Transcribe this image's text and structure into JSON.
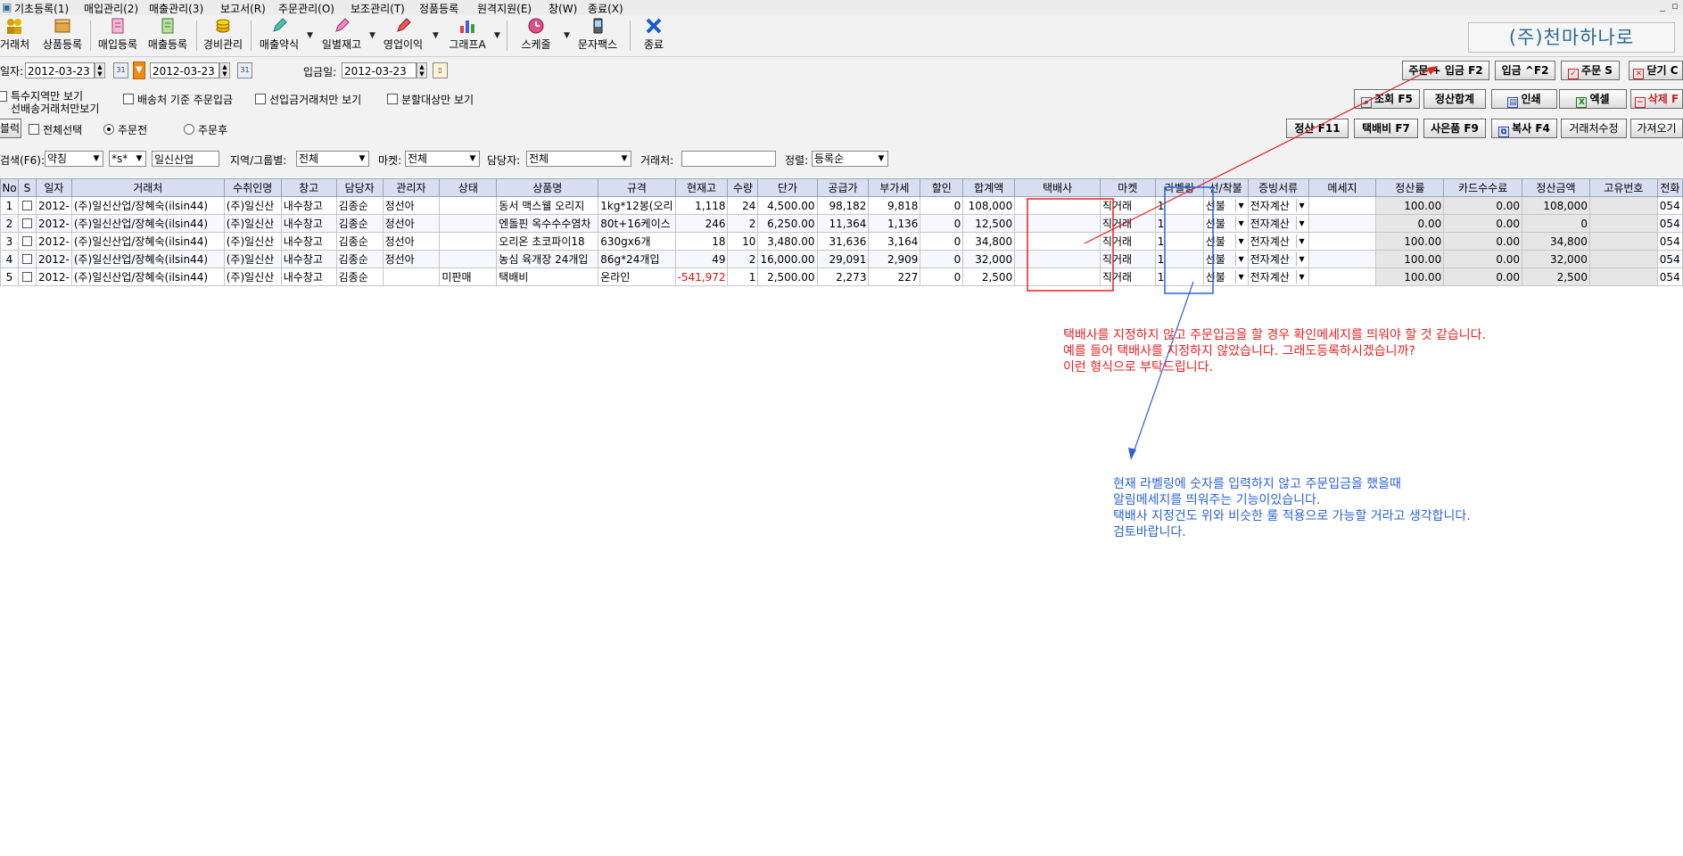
{
  "menu": [
    "기초등록(1)",
    "매입관리(2)",
    "매출관리(3)",
    "보고서(R)",
    "주문관리(O)",
    "보조관리(T)",
    "정품등록",
    "원격지원(E)",
    "창(W)",
    "종료(X)"
  ],
  "toolbar": {
    "items": [
      "거래처",
      "상품등록",
      "매입등록",
      "매출등록",
      "경비관리",
      "매출약식",
      "일별재고",
      "영업이익",
      "그래프A",
      "스케줄",
      "문자팩스",
      "종료"
    ],
    "brand": "(주)천마하나로"
  },
  "dates": {
    "label_date": "일자:",
    "from": "2012-03-23",
    "to": "2012-03-23",
    "label_deposit": "입금일:",
    "deposit": "2012-03-23"
  },
  "buttons_row1": [
    "주문 + 입금 F2",
    "입금 ^F2",
    "주문 S",
    "닫기 C"
  ],
  "options": {
    "special_region": "특수지역만 보기",
    "pre_ship": "선배송거래처만보기",
    "ship_base_order": "배송처 기준 주문입금",
    "prepaid_only": "선입금거래처만 보기",
    "split_only": "분할대상만 보기"
  },
  "buttons_row2": [
    "조회 F5",
    "정산합계",
    "인쇄",
    "엑셀",
    "삭제 F"
  ],
  "select_bar": {
    "block": "블럭",
    "select_all": "전체선택",
    "before_order": "주문전",
    "after_order": "주문후"
  },
  "buttons_row3": [
    "정산 F11",
    "택배비 F7",
    "사은품 F9",
    "복사 F4",
    "거래처수정",
    "가져오기"
  ],
  "search": {
    "label": "검색(F6):",
    "type": "약칭",
    "op": "*s*",
    "value": "일신산업",
    "region_label": "지역/그룹별:",
    "region": "전체",
    "market_label": "마켓:",
    "market": "전체",
    "manager_label": "담당자:",
    "manager": "전체",
    "client_label": "거래처:",
    "client": "",
    "sort_label": "정렬:",
    "sort": "등록순"
  },
  "table": {
    "headers": [
      "No",
      "S",
      "일자",
      "거래처",
      "수취인명",
      "창고",
      "담당자",
      "관리자",
      "상태",
      "상품명",
      "규격",
      "현재고",
      "수량",
      "단가",
      "공급가",
      "부가세",
      "할인",
      "합계액",
      "택배사",
      "마켓",
      "라벨링",
      "선/착불",
      "증빙서류",
      "메세지",
      "정산률",
      "카드수수료",
      "정산금액",
      "고유번호",
      "전화"
    ],
    "rows": [
      [
        "1",
        "",
        "2012-",
        "(주)일신산업/장혜숙(ilsin44)",
        "(주)일신산",
        "내수창고",
        "김종순",
        "정선아",
        "",
        "동서 맥스웰 오리지",
        "1kg*12봉(오리",
        "1,118",
        "24",
        "4,500.00",
        "98,182",
        "9,818",
        "0",
        "108,000",
        "",
        "직거래",
        "1",
        "선불",
        "전자계산",
        "",
        "100.00",
        "0.00",
        "108,000",
        "",
        "054"
      ],
      [
        "2",
        "",
        "2012-",
        "(주)일신산업/장혜숙(ilsin44)",
        "(주)일신산",
        "내수창고",
        "김종순",
        "정선아",
        "",
        "엔돌핀 옥수수수염차",
        "80t+16케이스",
        "246",
        "2",
        "6,250.00",
        "11,364",
        "1,136",
        "0",
        "12,500",
        "",
        "직거래",
        "1",
        "선불",
        "전자계산",
        "",
        "0.00",
        "0.00",
        "0",
        "",
        "054"
      ],
      [
        "3",
        "",
        "2012-",
        "(주)일신산업/장혜숙(ilsin44)",
        "(주)일신산",
        "내수창고",
        "김종순",
        "정선아",
        "",
        "오리온 초코파이18",
        "630gx6개",
        "18",
        "10",
        "3,480.00",
        "31,636",
        "3,164",
        "0",
        "34,800",
        "",
        "직거래",
        "1",
        "선불",
        "전자계산",
        "",
        "100.00",
        "0.00",
        "34,800",
        "",
        "054"
      ],
      [
        "4",
        "",
        "2012-",
        "(주)일신산업/장혜숙(ilsin44)",
        "(주)일신산",
        "내수창고",
        "김종순",
        "정선아",
        "",
        "농심 육개장 24개입",
        "86g*24개입",
        "49",
        "2",
        "16,000.00",
        "29,091",
        "2,909",
        "0",
        "32,000",
        "",
        "직거래",
        "1",
        "선불",
        "전자계산",
        "",
        "100.00",
        "0.00",
        "32,000",
        "",
        "054"
      ],
      [
        "5",
        "",
        "2012-",
        "(주)일신산업/장혜숙(ilsin44)",
        "(주)일신산",
        "내수창고",
        "김종순",
        "",
        "미판매",
        "택배비",
        "온라인",
        "-541,972",
        "1",
        "2,500.00",
        "2,273",
        "227",
        "0",
        "2,500",
        "",
        "직거래",
        "1",
        "선불",
        "전자계산",
        "",
        "100.00",
        "0.00",
        "2,500",
        "",
        "054"
      ]
    ]
  },
  "annotations": {
    "red": [
      "택배사를 지정하지 않고 주문입금을 할 경우 확인메세지를 띄워야 할 것 같습니다.",
      "예를 들어 택배사를 지정하지 않았습니다. 그래도등록하시겠습니까?",
      "이런 형식으로 부탁드립니다."
    ],
    "blue": [
      "현재 라벨링에 숫자를 입력하지 않고 주문입금을 했을때",
      "알림메세지를 띄워주는 기능이있습니다.",
      "택배사 지정건도 위와 비슷한 룰 적용으로 가능할 거라고 생각합니다.",
      "검토바랍니다."
    ]
  },
  "colors": {
    "header_bg": "#d8dff2",
    "annotation_red": "#e82020",
    "annotation_blue": "#2a63d6",
    "negative": "#e01010"
  }
}
